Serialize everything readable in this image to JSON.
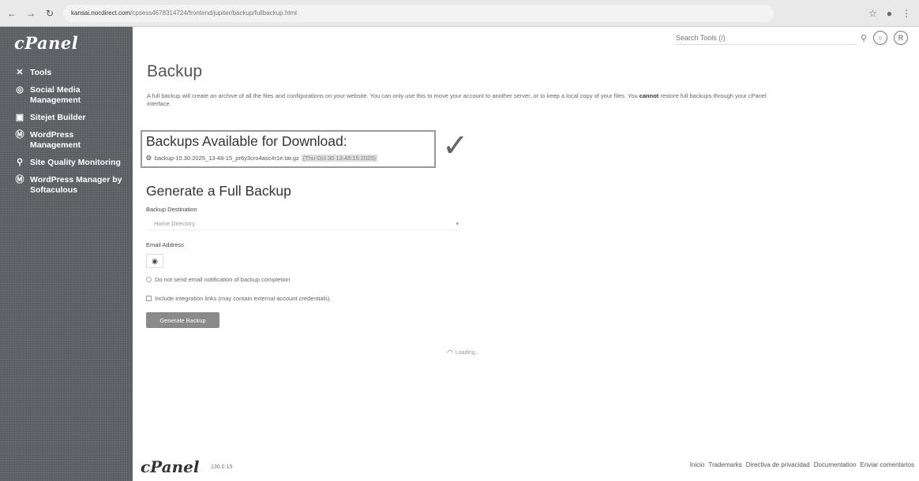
{
  "browser": {
    "url_host": "kansai.nocdirect.com",
    "url_path": "/cpsess4678314724/frontend/jupiter/backup/fullbackup.html"
  },
  "sidebar": {
    "logo": "cPanel",
    "items": [
      {
        "label": "Tools",
        "icon": "tools-icon"
      },
      {
        "label": "Social Media Management",
        "icon": "social-media-icon"
      },
      {
        "label": "Sitejet Builder",
        "icon": "sitejet-icon"
      },
      {
        "label": "WordPress Management",
        "icon": "wordpress-icon"
      },
      {
        "label": "Site Quality Monitoring",
        "icon": "search-icon"
      },
      {
        "label": "WordPress Manager by Softaculous",
        "icon": "wordpress-icon"
      }
    ]
  },
  "header": {
    "search_placeholder": "Search Tools (/)"
  },
  "main": {
    "title": "Backup",
    "description_part1": "A full backup will create an archive of all the files and configurations on your website. You can only use this to move your account to another server, or to keep a local copy of your files. You ",
    "description_bold": "cannot",
    "description_part2": " restore full backups through your cPanel interface.",
    "available_title": "Backups Available for Download:",
    "backup_file": "backup-10.30.2025_13-48-15_pr6y3cro4asc4r1e.tar.gz",
    "backup_date": "(Thu Oct 30 13:48:15 2025)",
    "generate_title": "Generate a Full Backup",
    "destination_label": "Backup Destination",
    "destination_value": "Home Directory",
    "email_label": "Email Address",
    "no_email_label": "Do not send email notification of backup completion",
    "integration_label": "Include integration links (may contain external account credentials).",
    "generate_button": "Generate Backup",
    "loading_text": "Loading..."
  },
  "footer": {
    "logo": "cPanel",
    "version": "130.0.15",
    "links": [
      "Inicio",
      "Trademarks",
      "Directiva de privacidad",
      "Documentation",
      "Enviar comentarios"
    ]
  }
}
